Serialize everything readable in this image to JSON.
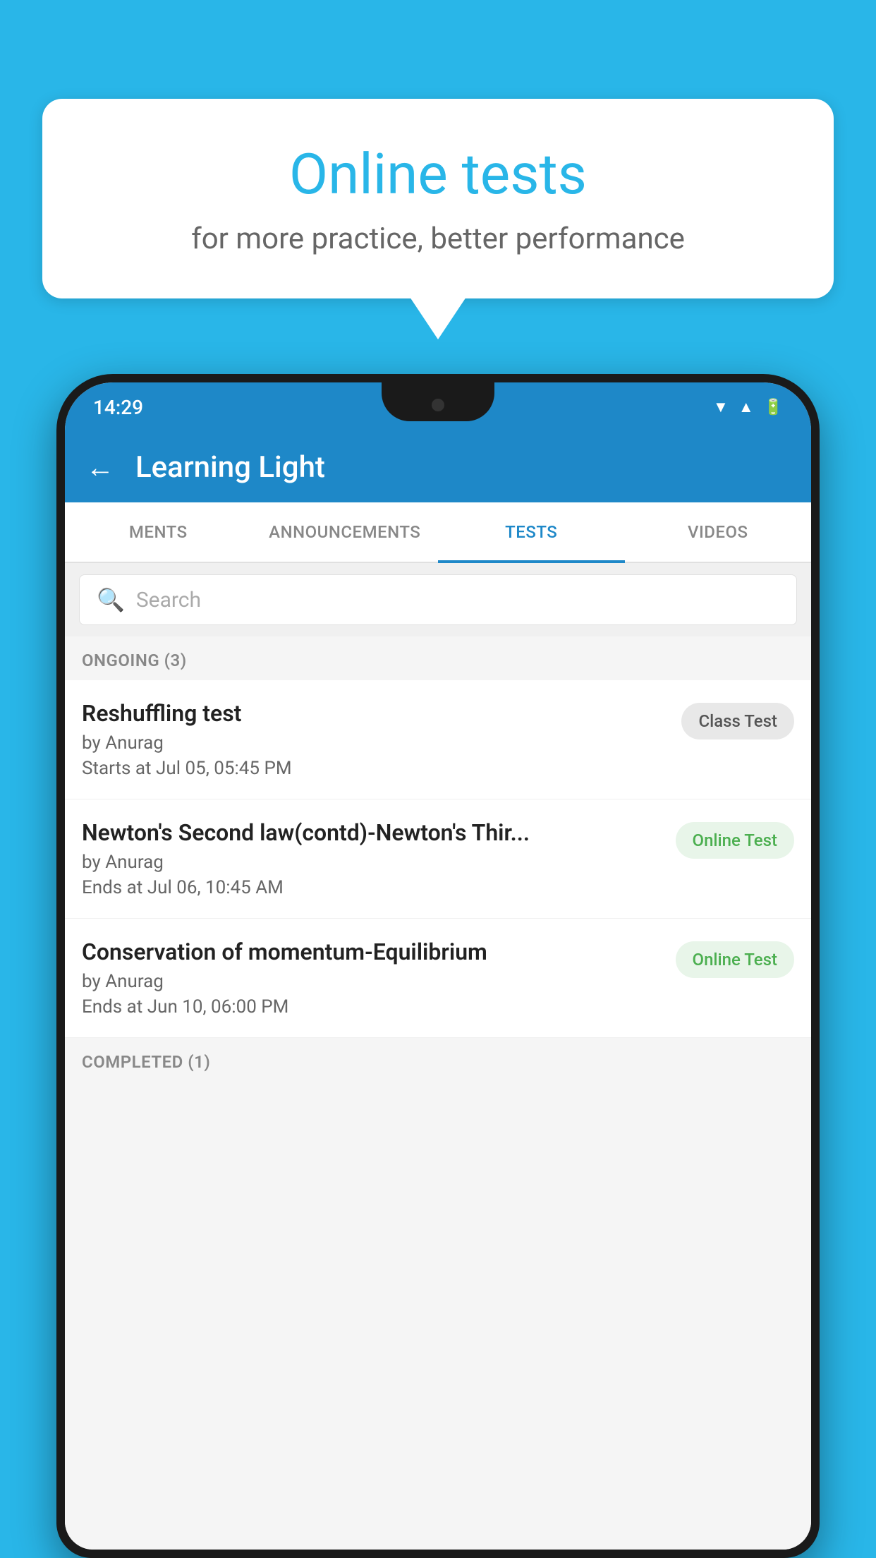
{
  "background_color": "#29B6E8",
  "speech_bubble": {
    "title": "Online tests",
    "subtitle": "for more practice, better performance"
  },
  "status_bar": {
    "time": "14:29",
    "wifi": "▼",
    "signal": "▲",
    "battery": "▮"
  },
  "app_bar": {
    "title": "Learning Light",
    "back_label": "←"
  },
  "tabs": [
    {
      "label": "MENTS",
      "active": false
    },
    {
      "label": "ANNOUNCEMENTS",
      "active": false
    },
    {
      "label": "TESTS",
      "active": true
    },
    {
      "label": "VIDEOS",
      "active": false
    }
  ],
  "search": {
    "placeholder": "Search"
  },
  "ongoing_section": {
    "title": "ONGOING (3)"
  },
  "tests": [
    {
      "name": "Reshuffling test",
      "author": "by Anurag",
      "time_label": "Starts at",
      "time": "Jul 05, 05:45 PM",
      "badge": "Class Test",
      "badge_type": "class"
    },
    {
      "name": "Newton's Second law(contd)-Newton's Thir...",
      "author": "by Anurag",
      "time_label": "Ends at",
      "time": "Jul 06, 10:45 AM",
      "badge": "Online Test",
      "badge_type": "online"
    },
    {
      "name": "Conservation of momentum-Equilibrium",
      "author": "by Anurag",
      "time_label": "Ends at",
      "time": "Jun 10, 06:00 PM",
      "badge": "Online Test",
      "badge_type": "online"
    }
  ],
  "completed_section": {
    "title": "COMPLETED (1)"
  }
}
